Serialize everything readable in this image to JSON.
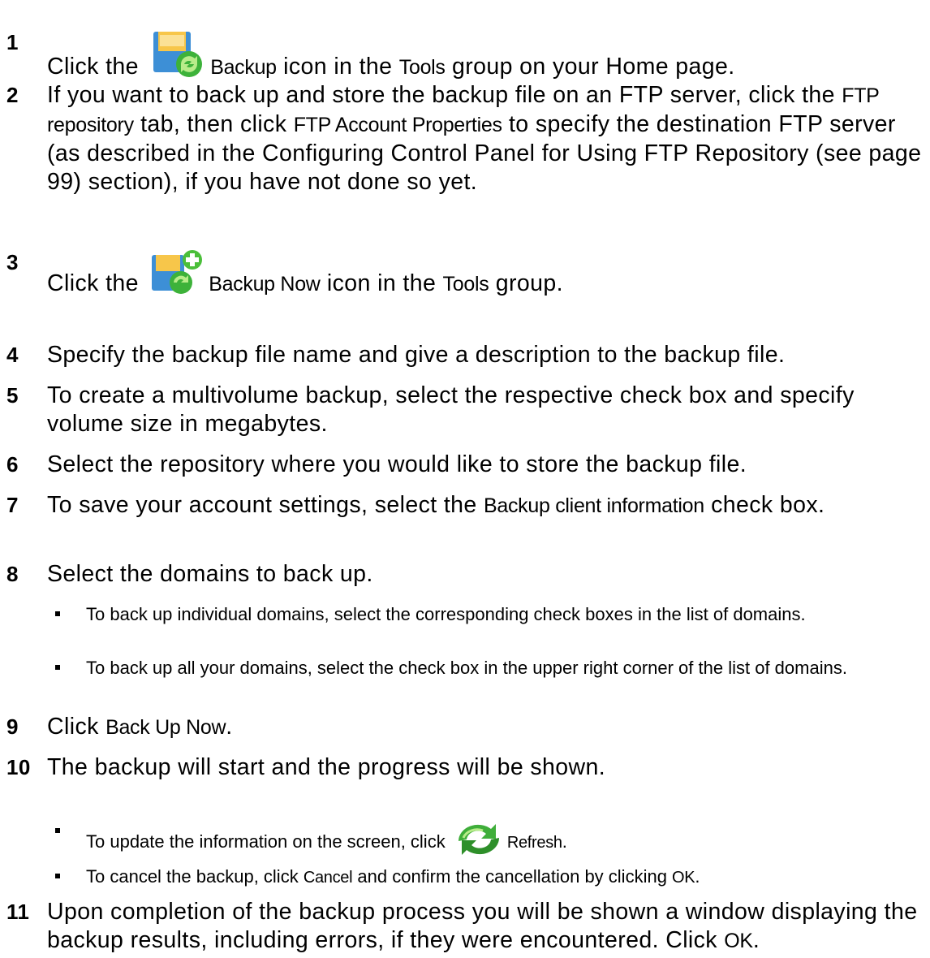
{
  "steps": [
    {
      "num": "1",
      "t1": "Click the ",
      "b1": "Backup",
      "t2": " icon in the ",
      "b2": "Tools",
      "t3": " group on your Home page."
    },
    {
      "num": "2",
      "t1": "If you want to back up and store the backup file on an FTP server, click the ",
      "b1": "FTP repository",
      "t2": " tab, then click ",
      "b2": "FTP Account Properties",
      "t3": " to specify the destination FTP server (as described in the Configuring Control Panel for Using FTP Repository (see page 99) section), if you have not done so yet."
    },
    {
      "num": "3",
      "t1": "Click the ",
      "b1": "Backup Now",
      "t2": " icon in the ",
      "b2": "Tools",
      "t3": " group."
    },
    {
      "num": "4",
      "text": "Specify the backup file name and give a description to the backup file."
    },
    {
      "num": "5",
      "text": "To create a multivolume backup, select the respective check box and specify volume size in megabytes."
    },
    {
      "num": "6",
      "text": "Select the repository where you would like to store the backup file."
    },
    {
      "num": "7",
      "t1": "To save your account settings, select the ",
      "b1": "Backup client information",
      "t2": " check box."
    },
    {
      "num": "8",
      "text": "Select the domains to back up."
    },
    {
      "num": "9",
      "t1": "Click ",
      "b1": "Back Up Now",
      "t2": "."
    },
    {
      "num": "10",
      "text": "The backup will start and the progress will be shown."
    },
    {
      "num": "11",
      "t1": "Upon completion of the backup process you will be shown a window displaying the backup results, including errors, if they were encountered. Click ",
      "b1": "OK",
      "t2": "."
    }
  ],
  "step8_bullets": [
    "To back up individual domains, select the corresponding check boxes in the list of domains.",
    "To back up all your domains, select the check box in the upper right corner of the list of domains."
  ],
  "step10_bullets": [
    {
      "t1": "To update the information on the screen, click ",
      "b1": "Refresh",
      "t2": "."
    },
    {
      "t1": "To cancel the backup, click ",
      "b1": "Cancel",
      "t2": " and confirm the cancellation by clicking ",
      "b2": "OK",
      "t3": "."
    }
  ],
  "icons": {
    "step1": "backup-icon",
    "step3": "backup-now-icon",
    "step10": "refresh-icon"
  }
}
